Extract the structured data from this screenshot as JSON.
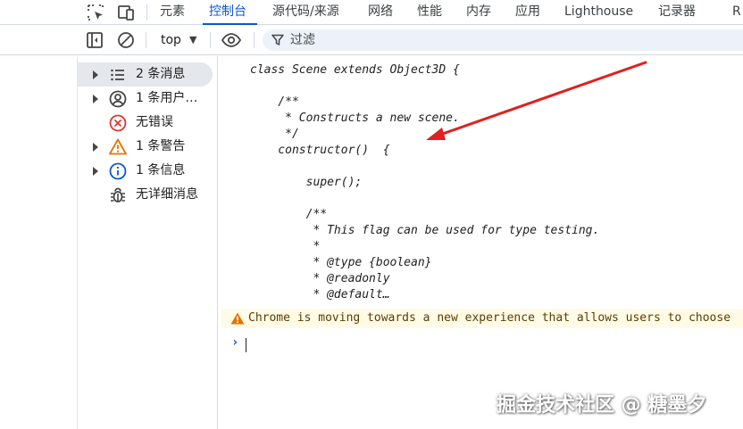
{
  "tabs": [
    {
      "label": "元素"
    },
    {
      "label": "控制台"
    },
    {
      "label": "源代码/来源"
    },
    {
      "label": "网络"
    },
    {
      "label": "性能"
    },
    {
      "label": "内存"
    },
    {
      "label": "应用"
    },
    {
      "label": "Lighthouse"
    },
    {
      "label": "记录器"
    },
    {
      "label": "R"
    }
  ],
  "active_tab": "控制台",
  "toolbar": {
    "context": "top",
    "filter_placeholder": "过滤"
  },
  "sidebar": {
    "items": [
      {
        "label": "2 条消息",
        "icon": "list-icon"
      },
      {
        "label": "1 条用户…",
        "icon": "user-icon"
      },
      {
        "label": "无错误",
        "icon": "error-icon"
      },
      {
        "label": "1 条警告",
        "icon": "warning-icon"
      },
      {
        "label": "1 条信息",
        "icon": "info-icon"
      },
      {
        "label": "无详细消息",
        "icon": "bug-icon"
      }
    ]
  },
  "console": {
    "code_lines": [
      "class Scene extends Object3D {",
      "",
      "    /**",
      "     * Constructs a new scene.",
      "     */",
      "    constructor()  {",
      "",
      "        super();",
      "",
      "        /**",
      "         * This flag can be used for type testing.",
      "         *",
      "         * @type {boolean}",
      "         * @readonly",
      "         * @default…"
    ],
    "warning": "Chrome is moving towards a new experience that allows users to choose",
    "prompt": "›"
  },
  "watermark": "掘金技术社区 @ 糖墨夕",
  "colors": {
    "accent": "#0b57d0",
    "warning_bg": "#fffbe6",
    "warning_icon": "#e37400",
    "error_icon": "#dc362e",
    "info_icon": "#0b57d0",
    "arrow": "#e02020"
  }
}
